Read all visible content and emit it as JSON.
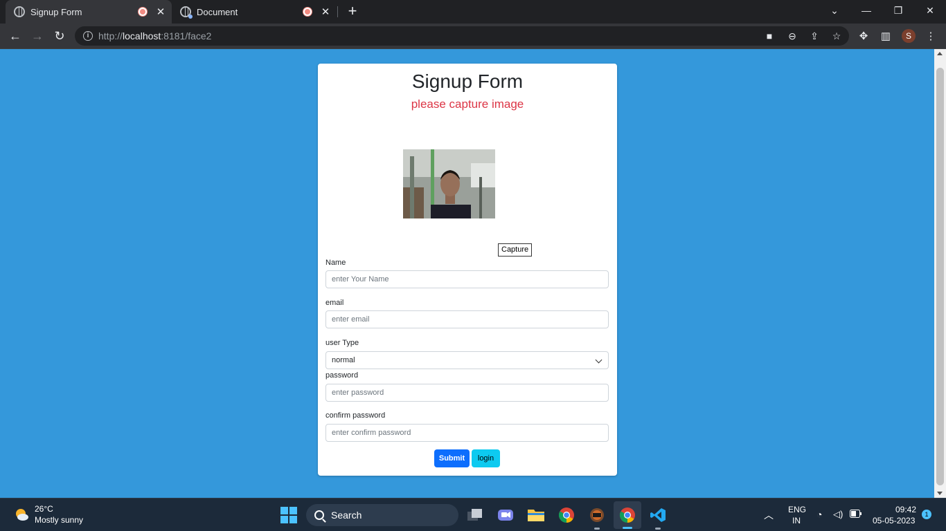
{
  "browser": {
    "tabs": [
      {
        "title": "Signup Form"
      },
      {
        "title": "Document"
      }
    ],
    "url": {
      "prefix": "http://",
      "host": "localhost",
      "rest": ":8181/face2"
    },
    "profile_initial": "S"
  },
  "page": {
    "title": "Signup Form",
    "status_message": "please capture image",
    "capture_label": "Capture",
    "fields": {
      "name": {
        "label": "Name",
        "placeholder": "enter Your Name"
      },
      "email": {
        "label": "email",
        "placeholder": "enter email"
      },
      "user_type": {
        "label": "user Type",
        "selected": "normal"
      },
      "password": {
        "label": "password",
        "placeholder": "enter password"
      },
      "confirm_password": {
        "label": "confirm password",
        "placeholder": "enter confirm password"
      }
    },
    "submit_label": "Submit",
    "login_label": "login",
    "colors": {
      "background": "#3498db",
      "error": "#dc3545",
      "submit": "#0d6efd",
      "login": "#0dcaf0"
    }
  },
  "taskbar": {
    "weather": {
      "temp": "26°C",
      "desc": "Mostly sunny"
    },
    "search_label": "Search",
    "language": {
      "line1": "ENG",
      "line2": "IN"
    },
    "clock": {
      "time": "09:42",
      "date": "05-05-2023"
    },
    "notification_count": "1"
  }
}
